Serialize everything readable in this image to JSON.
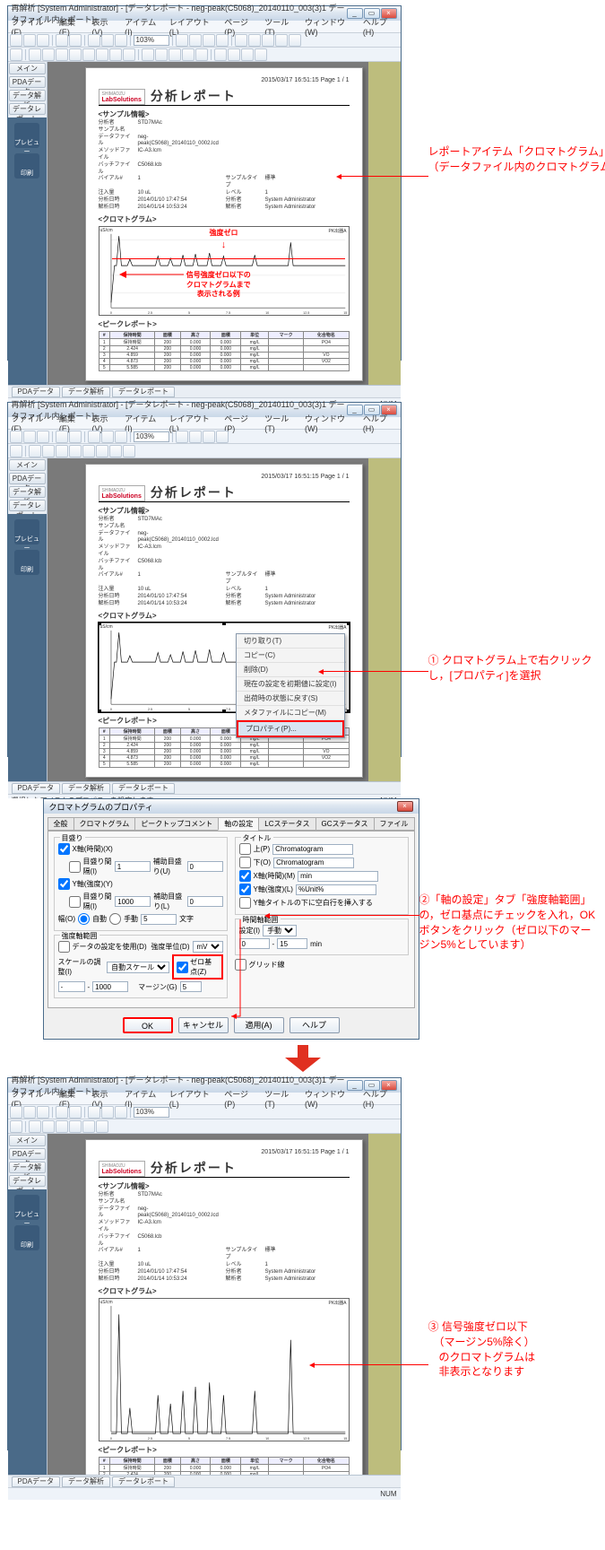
{
  "win": {
    "title": "再解析 [System Administrator] - [データレポート - neg-peak(C5068)_20140110_003(3)1 データファイル内レポート]",
    "menus": [
      "ファイル(F)",
      "編集(E)",
      "表示(V)",
      "アイテム(I)",
      "レイアウト(L)",
      "ページ(P)",
      "ツール(T)",
      "ウィンドウ(W)",
      "ヘルプ(H)"
    ],
    "zoom": "103%",
    "sidebar": {
      "tabs": [
        "メイン",
        "PDAデータ",
        "データ解析",
        "データレポート"
      ],
      "icons": [
        "プレビュー",
        "印刷"
      ]
    },
    "bottom_tabs": [
      "PDAデータ",
      "データ解析",
      "データレポート"
    ],
    "status_left": "選択したアイテムのプロパティを設定します。",
    "status_right": "NUM"
  },
  "sheet": {
    "pagenum": "2015/03/17 16:51:15  Page 1 / 1",
    "brand_top": "SHIMADZU",
    "brand": "LabSolutions",
    "title": "分析レポート",
    "sec_sample": "<サンプル情報>",
    "sec_chrom": "<クロマトグラム>",
    "sec_peak": "<ピークレポート>",
    "ylab": "uS/cm",
    "rlab": "PK出器A",
    "info": [
      [
        "分析者",
        "STD7MAc",
        "",
        ""
      ],
      [
        "サンプル名",
        "",
        "",
        ""
      ],
      [
        "データファイル",
        "neg-peak(C5068)_20140110_0002.lcd",
        "",
        ""
      ],
      [
        "メソッドファイル",
        "IC-A3.lcm",
        "",
        ""
      ],
      [
        "バッチファイル",
        "C5068.lcb",
        "",
        ""
      ],
      [
        "バイアル#",
        "1",
        "サンプルタイプ",
        "標準"
      ],
      [
        "注入量",
        "10 uL",
        "レベル",
        "1"
      ],
      [
        "分析日時",
        "2014/01/10 17:47:54",
        "分析者",
        "System Administrator"
      ],
      [
        "解析日時",
        "2014/01/14 10:53:24",
        "解析者",
        "System Administrator"
      ]
    ],
    "peakheaders": [
      "#",
      "保持時間",
      "面積",
      "高さ",
      "面積",
      "単位",
      "マーク",
      "化合物名"
    ],
    "peaks": [
      [
        "1",
        "保持時間",
        "200",
        "0.000",
        "0.000",
        "mg/L",
        "",
        "PO4"
      ],
      [
        "2",
        "2.424",
        "200",
        "0.000",
        "0.000",
        "mg/L",
        "",
        ""
      ],
      [
        "3",
        "4.859",
        "200",
        "0.000",
        "0.000",
        "mg/L",
        "",
        "VO"
      ],
      [
        "4",
        "4.873",
        "200",
        "0.000",
        "0.000",
        "mg/L",
        "",
        "VO2"
      ],
      [
        "5",
        "5.585",
        "200",
        "0.000",
        "0.000",
        "mg/L",
        "",
        ""
      ]
    ]
  },
  "chart_data": {
    "type": "line",
    "title": "クロマトグラム",
    "xlabel": "min",
    "ylabel": "uS/cm",
    "xlim": [
      0,
      15
    ],
    "ylim_neg": [
      -4,
      3
    ],
    "ylim_pos": [
      0,
      3
    ],
    "xticks": [
      0,
      2.5,
      5,
      7.5,
      10,
      12.5,
      15
    ],
    "peaks_x": [
      0.5,
      1.2,
      3.0,
      3.8,
      4.6,
      5.4,
      6.3,
      7.2,
      9.2,
      11.5
    ],
    "peaks_h": [
      2.8,
      0.6,
      0.9,
      0.7,
      1.0,
      1.1,
      1.2,
      0.9,
      1.0,
      2.2
    ],
    "baseline_min": -3.5
  },
  "chart_anno": {
    "zero_label": "強度ゼロ",
    "neg_label": "信号強度ゼロ以下の\nクロマトグラムまで\n表示される例"
  },
  "ctx": {
    "items": [
      "切り取り(T)",
      "コピー(C)",
      "削除(D)",
      "現在の設定を初期値に設定(I)",
      "出荷時の状態に戻す(S)",
      "メタファイルにコピー(M)"
    ],
    "hl": "プロパティ(P)..."
  },
  "dlg": {
    "title": "クロマトグラムのプロパティ",
    "tabs": [
      "全般",
      "クロマトグラム",
      "ピークトップコメント",
      "軸の設定",
      "LCステータス",
      "GCステータス",
      "ファイル"
    ],
    "active_tab": "軸の設定",
    "grp_scale": "目盛り",
    "cb_xtime": "X軸(時間)(X)",
    "xtime_dec": "0",
    "xtime_sub": "補助目盛り(U)",
    "xtime_sub_v": "0",
    "cb_interval": "目盛り間隔(I)",
    "interval_v": "1",
    "cb_yint": "Y軸(強度)(Y)",
    "yint_sub": "補助目盛り(L)",
    "yint_sub_v": "0",
    "cb_yinterval": "目盛り間隔(I)",
    "yinterval_v": "1000",
    "width_lbl": "幅(O)",
    "width_auto": "自動",
    "width_manual": "手動",
    "width_v": "5",
    "width_unit": "文字",
    "grp_range": "強度軸範囲",
    "cb_usedata": "データの設定を使用(D)",
    "unit_lbl": "強度単位(D)",
    "unit_v": "mV",
    "scale_lbl": "スケールの調整(I)",
    "scale_v": "自動スケール",
    "zero_cb": "ゼロ基点(Z)",
    "from": "-",
    "to": "1000",
    "margin_lbl": "マージン(G)",
    "margin_v": "5",
    "grp_title": "タイトル",
    "cb_top": "上(P)",
    "top_v": "Chromatogram",
    "cb_bot": "下(O)",
    "bot_v": "Chromatogram",
    "cb_x": "X軸(時間)(M)",
    "x_v": "min",
    "cb_y": "Y軸(強度)(L)",
    "y_v": "%Unit%",
    "cb_blank": "Y軸タイトルの下に空白行を挿入する",
    "grp_trange": "時間軸範囲",
    "trange_lbl": "設定(I)",
    "trange_v": "手動",
    "trange_from": "0",
    "trange_to": "15",
    "trange_unit": "min",
    "grid_cb": "グリッド線",
    "ok": "OK",
    "cancel": "キャンセル",
    "apply": "適用(A)",
    "help": "ヘルプ"
  },
  "notes": {
    "n1": "レポートアイテム「クロマトグラム」\n（データファイル内のクロマトグラムや装置のステータス情報を表示します）",
    "n2": "① クロマトグラム上で右クリックし，[プロパティ]を選択",
    "n3": "②「軸の設定」タブ「強度軸範囲」の，ゼロ基点にチェックを入れ，OKボタンをクリック（ゼロ以下のマージン5%としています）",
    "n4": "③ 信号強度ゼロ以下\n　（マージン5%除く）\n　のクロマトグラムは\n　非表示となります"
  }
}
